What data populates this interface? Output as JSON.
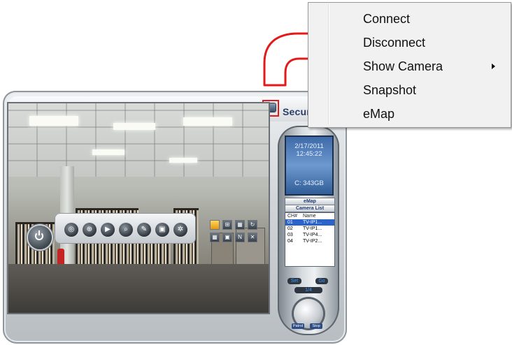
{
  "app": {
    "title": "Secur",
    "lcd": {
      "date": "2/17/2011",
      "time": "12:45:22",
      "capacity": "C: 343GB"
    },
    "panel_buttons": {
      "emap": "eMap",
      "camera_list": "Camera List"
    },
    "camera_list": {
      "headers": [
        "CH#",
        "Name"
      ],
      "rows": [
        {
          "ch": "01",
          "name": "TV-IP1..."
        },
        {
          "ch": "02",
          "name": "TV-IP1..."
        },
        {
          "ch": "03",
          "name": "TV-IP4..."
        },
        {
          "ch": "04",
          "name": "TV-IP2..."
        }
      ]
    },
    "nav": {
      "set": "Set",
      "go": "Go",
      "page": "1/4"
    },
    "ptz": {
      "patrol": "Patrol",
      "stop": "Stop"
    }
  },
  "context_menu": {
    "items": [
      "Connect",
      "Disconnect",
      "Show Camera",
      "Snapshot",
      "eMap"
    ]
  },
  "colors": {
    "highlight_box": "#e31a1a",
    "arrow": "#e31a1a",
    "selected_row": "#2a64c8"
  },
  "icons": {
    "toolbar": [
      "settings-icon",
      "network-icon",
      "play-icon",
      "search-icon",
      "snapshot-icon",
      "record-icon",
      "gear-icon"
    ],
    "layout": [
      "single-layout",
      "quad-layout",
      "nine-layout",
      "rotate",
      "sixteen-layout",
      "full-layout",
      "n-layout",
      "fullscreen"
    ]
  }
}
